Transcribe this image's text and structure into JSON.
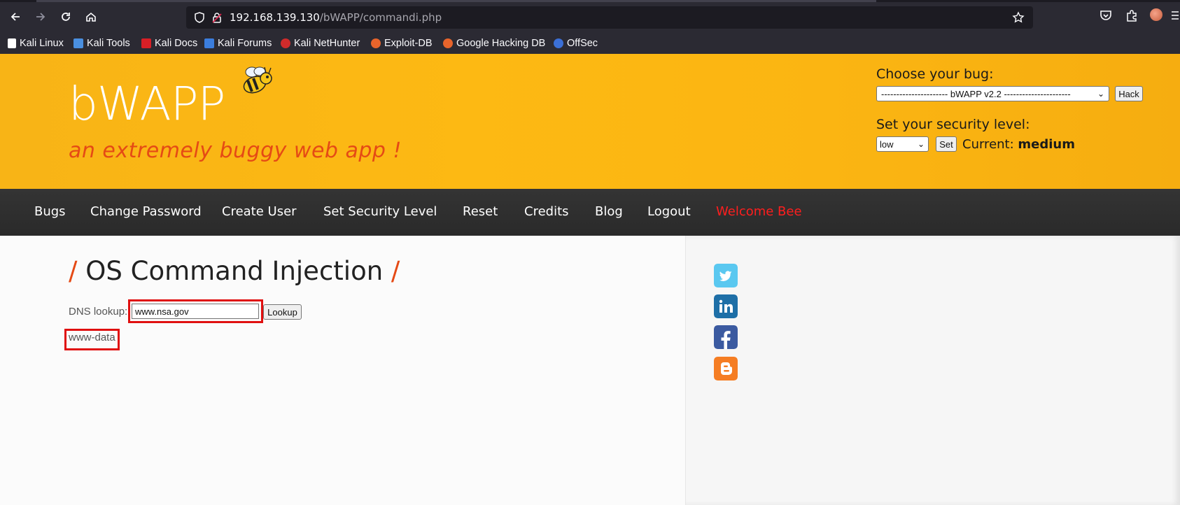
{
  "browser": {
    "url_host": "192.168.139.130",
    "url_path": "/bWAPP/commandi.php",
    "bookmarks": [
      {
        "label": "Kali Linux",
        "icon": "kali-dragon-icon"
      },
      {
        "label": "Kali Tools",
        "icon": "kali-tools-icon"
      },
      {
        "label": "Kali Docs",
        "icon": "kali-docs-icon"
      },
      {
        "label": "Kali Forums",
        "icon": "kali-forums-icon"
      },
      {
        "label": "Kali NetHunter",
        "icon": "nethunter-icon"
      },
      {
        "label": "Exploit-DB",
        "icon": "exploitdb-icon"
      },
      {
        "label": "Google Hacking DB",
        "icon": "ghdb-icon"
      },
      {
        "label": "OffSec",
        "icon": "offsec-icon"
      }
    ]
  },
  "header": {
    "logo": "bWAPP",
    "tagline": "an extremely buggy web app !",
    "choose_bug_label": "Choose your bug:",
    "bug_select_value": "---------------------- bWAPP v2.2 ----------------------",
    "hack_button": "Hack",
    "security_label": "Set your security level:",
    "security_select_value": "low",
    "set_button": "Set",
    "current_label": "Current:",
    "current_value": "medium"
  },
  "menu": {
    "items": [
      "Bugs",
      "Change Password",
      "Create User",
      "Set Security Level",
      "Reset",
      "Credits",
      "Blog",
      "Logout"
    ],
    "welcome": "Welcome Bee"
  },
  "main": {
    "title_slash": "/",
    "title": "OS Command Injection",
    "dns_label": "DNS lookup:",
    "dns_value": "www.nsa.gov",
    "lookup_button": "Lookup",
    "output": "www-data"
  },
  "social": [
    "twitter-icon",
    "linkedin-icon",
    "facebook-icon",
    "blogger-icon"
  ],
  "colors": {
    "header_bg": "#fdb913",
    "tagline": "#e54a15",
    "menu_bg": "#2f2f2f",
    "welcome": "#ff1e1e",
    "highlight_box": "#e01010"
  }
}
